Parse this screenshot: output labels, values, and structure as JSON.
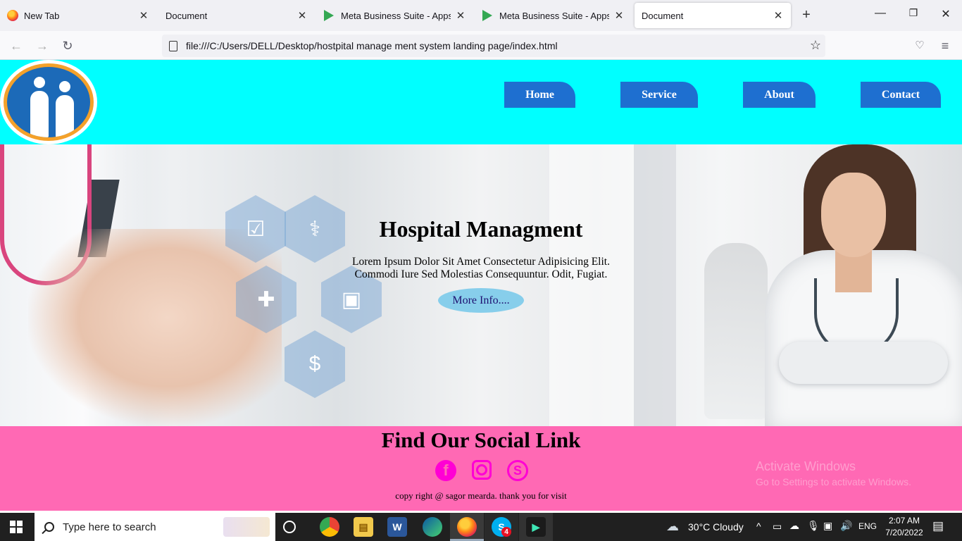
{
  "browser": {
    "tabs": [
      {
        "title": "New Tab",
        "icon": "firefox-icon"
      },
      {
        "title": "Document",
        "icon": ""
      },
      {
        "title": "Meta Business Suite - Apps on G",
        "icon": "google-play-icon"
      },
      {
        "title": "Meta Business Suite - Apps on G",
        "icon": "google-play-icon"
      },
      {
        "title": "Document",
        "icon": "",
        "active": true
      }
    ],
    "url": "file:///C:/Users/DELL/Desktop/hostpital manage ment system landing page/index.html"
  },
  "page": {
    "nav": [
      "Home",
      "Service",
      "About",
      "Contact"
    ],
    "hero": {
      "title": "Hospital Managment",
      "desc_line1": "Lorem Ipsum Dolor Sit Amet Consectetur Adipisicing Elit.",
      "desc_line2": "Commodi Iure Sed Molestias Consequuntur. Odit, Fugiat.",
      "button": "More Info...."
    },
    "footer": {
      "title": "Find Our Social Link",
      "social": [
        "facebook-icon",
        "instagram-icon",
        "skype-icon"
      ],
      "copyright": "copy right @ sagor mearda. thank you for visit"
    },
    "watermark": {
      "line1": "Activate Windows",
      "line2": "Go to Settings to activate Windows."
    },
    "colors": {
      "header": "#00ffff",
      "nav": "#1e6fd0",
      "footer": "#ff69b4",
      "social": "#ff00d4",
      "button": "#87ceeb"
    }
  },
  "taskbar": {
    "search_placeholder": "Type here to search",
    "weather": "30°C  Cloudy",
    "lang": "ENG",
    "time": "2:07 AM",
    "date": "7/20/2022",
    "skype_badge": "4"
  }
}
